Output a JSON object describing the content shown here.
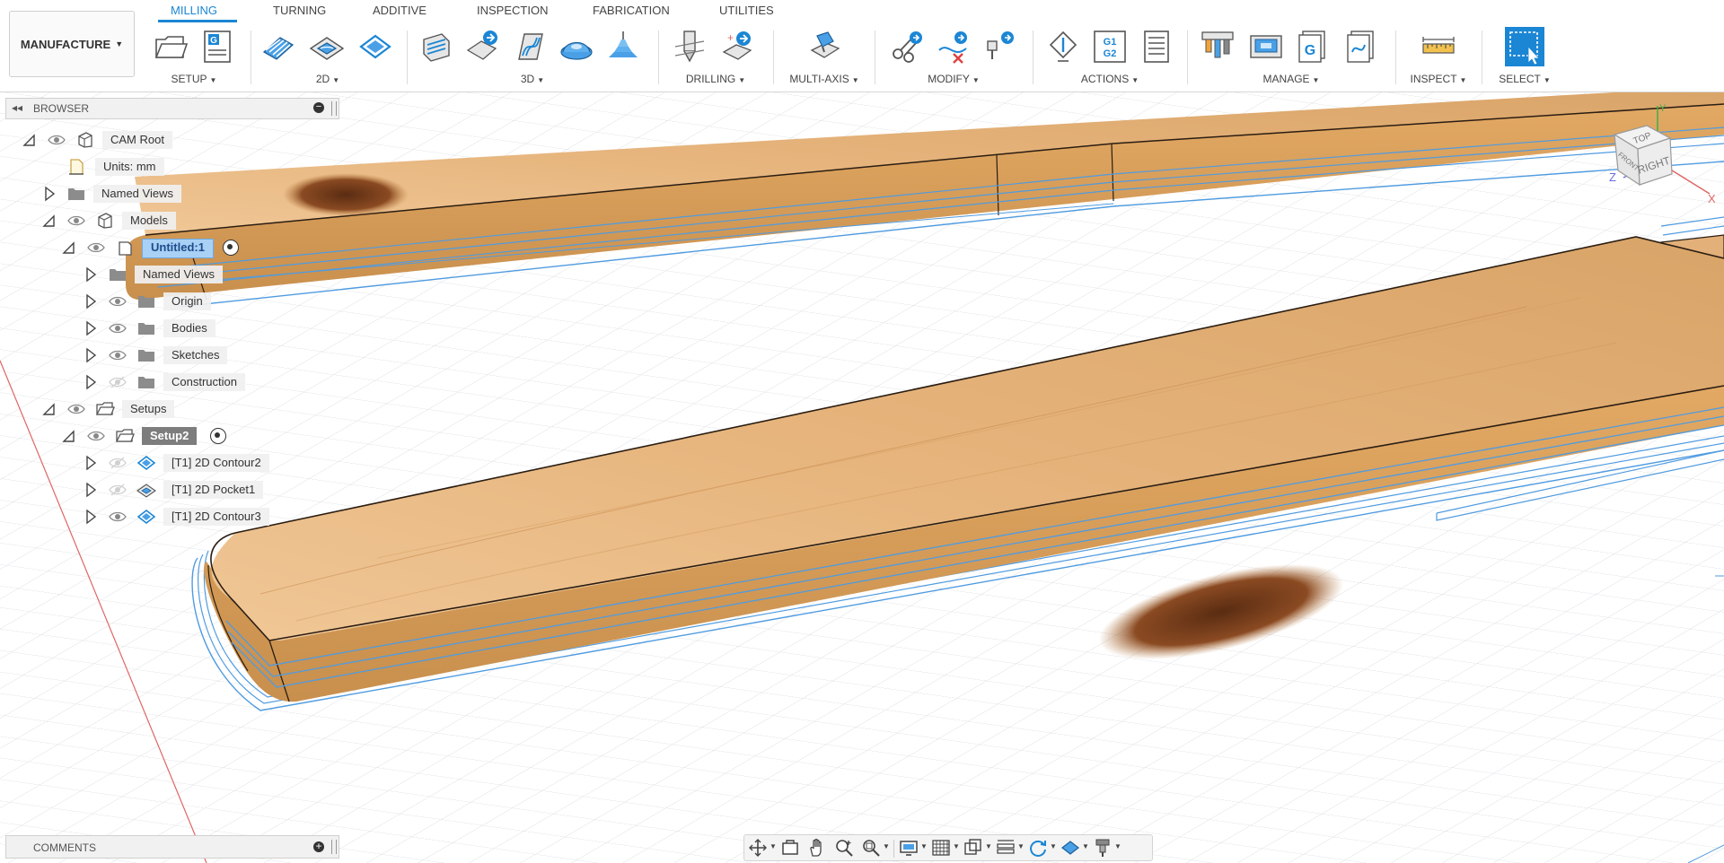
{
  "workspace": {
    "label": "MANUFACTURE"
  },
  "tabs": [
    {
      "label": "MILLING",
      "active": true
    },
    {
      "label": "TURNING"
    },
    {
      "label": "ADDITIVE"
    },
    {
      "label": "INSPECTION"
    },
    {
      "label": "FABRICATION"
    },
    {
      "label": "UTILITIES"
    }
  ],
  "groups": [
    {
      "label": "SETUP",
      "icons": [
        "setup-folder-icon",
        "setup-gcode-sheet-icon"
      ]
    },
    {
      "label": "2D",
      "icons": [
        "2d-adaptive-icon",
        "2d-pocket-icon",
        "2d-contour-icon"
      ]
    },
    {
      "label": "3D",
      "icons": [
        "3d-adaptive-icon",
        "3d-pocket-clearing-icon",
        "3d-flow-icon",
        "3d-steep-shallow-icon",
        "3d-contour-icon"
      ]
    },
    {
      "label": "DRILLING",
      "icons": [
        "drill-icon",
        "hole-recognition-icon"
      ]
    },
    {
      "label": "MULTI-AXIS",
      "icons": [
        "multi-axis-icon"
      ]
    },
    {
      "label": "MODIFY",
      "icons": [
        "scissors-icon",
        "delete-toolpath-icon",
        "tool-rotate-icon"
      ]
    },
    {
      "label": "ACTIONS",
      "icons": [
        "simulate-icon",
        "post-process-g1g2-icon",
        "setup-sheet-icon"
      ]
    },
    {
      "label": "MANAGE",
      "icons": [
        "tool-library-icon",
        "machine-library-icon",
        "post-library-icon",
        "template-library-icon"
      ]
    },
    {
      "label": "INSPECT",
      "icons": [
        "measure-icon"
      ]
    },
    {
      "label": "SELECT",
      "icons": [
        "select-cursor-icon"
      ]
    }
  ],
  "browser": {
    "title": "BROWSER",
    "nodes": {
      "cam_root": "CAM Root",
      "units": "Units: mm",
      "named_views_root": "Named Views",
      "models": "Models",
      "untitled": "Untitled:1",
      "named_views_model": "Named Views",
      "origin": "Origin",
      "bodies": "Bodies",
      "sketches": "Sketches",
      "construction": "Construction",
      "setups": "Setups",
      "setup2": "Setup2",
      "op_contour2": "[T1] 2D Contour2",
      "op_pocket1": "[T1] 2D Pocket1",
      "op_contour3": "[T1] 2D Contour3"
    }
  },
  "comments": {
    "title": "COMMENTS"
  },
  "viewcube": {
    "top": "TOP",
    "front": "FRONT",
    "right": "RIGHT",
    "axis_x": "X",
    "axis_y": "Y",
    "axis_z": "Z"
  },
  "colors": {
    "accent": "#1b86d4",
    "toolpath": "#4f9be0",
    "wood_light": "#e8b985",
    "wood_dark": "#c8914f",
    "selected_label": "#a9d0f5"
  }
}
